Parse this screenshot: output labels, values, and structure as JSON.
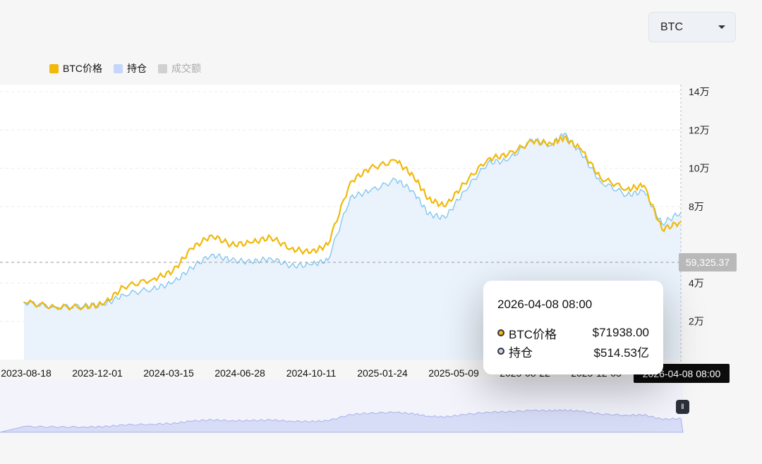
{
  "dropdown": {
    "value": "BTC"
  },
  "legend": [
    {
      "label": "BTC价格",
      "color": "#f0b90b",
      "active": true
    },
    {
      "label": "持仓",
      "color": "#c5d6fb",
      "active": true
    },
    {
      "label": "成交额",
      "color": "#c9c9c9",
      "active": false
    }
  ],
  "crosshair": {
    "price_label": "59,325.37",
    "time_label": "2026-04-08 08:00"
  },
  "tooltip": {
    "date": "2026-04-08 08:00",
    "rows": [
      {
        "label": "BTC价格",
        "value": "$71938.00",
        "color": "#f0b90b"
      },
      {
        "label": "持仓",
        "value": "$514.53亿",
        "color": "#c5d6fb"
      }
    ]
  },
  "chart_data": {
    "type": "line",
    "y_tick_labels": [
      "14万",
      "12万",
      "10万",
      "8万",
      "4万",
      "2万"
    ],
    "y_tick_values": [
      140000,
      120000,
      100000,
      80000,
      40000,
      20000
    ],
    "x_tick_labels": [
      "2023-08-18",
      "2023-12-01",
      "2024-03-15",
      "2024-06-28",
      "2024-10-11",
      "2025-01-24",
      "2025-05-09",
      "2025-08-22",
      "2025-12-05",
      "2026-04-08 08:00"
    ],
    "ylim": [
      0,
      140000
    ],
    "series": [
      {
        "name": "BTC价格",
        "color": "#f0b90b",
        "x": [
          "2023-07-01",
          "2023-08-18",
          "2023-10-01",
          "2023-11-01",
          "2023-12-01",
          "2024-01-15",
          "2024-02-15",
          "2024-03-15",
          "2024-04-15",
          "2024-05-15",
          "2024-06-15",
          "2024-07-15",
          "2024-08-15",
          "2024-09-15",
          "2024-10-11",
          "2024-11-15",
          "2024-12-15",
          "2025-01-24",
          "2025-02-20",
          "2025-03-15",
          "2025-04-10",
          "2025-05-09",
          "2025-06-15",
          "2025-07-15",
          "2025-08-22",
          "2025-09-20",
          "2025-10-10",
          "2025-11-05",
          "2025-12-05",
          "2026-01-15",
          "2026-02-10",
          "2026-03-10",
          "2026-04-08"
        ],
        "values": [
          30000,
          27500,
          27500,
          29000,
          38000,
          42000,
          46000,
          58000,
          65000,
          60000,
          61000,
          64000,
          58000,
          56000,
          60000,
          93000,
          100000,
          104000,
          96000,
          84000,
          80000,
          92000,
          105000,
          107000,
          114000,
          113000,
          116000,
          110000,
          95000,
          89000,
          91000,
          68000,
          71938
        ]
      },
      {
        "name": "持仓",
        "color": "#7dc4ef",
        "x": [
          "2023-07-01",
          "2023-08-18",
          "2023-10-01",
          "2023-11-01",
          "2023-12-01",
          "2024-01-15",
          "2024-02-15",
          "2024-03-15",
          "2024-04-15",
          "2024-05-15",
          "2024-06-15",
          "2024-07-15",
          "2024-08-15",
          "2024-09-15",
          "2024-10-11",
          "2024-11-15",
          "2024-12-15",
          "2025-01-24",
          "2025-02-20",
          "2025-03-15",
          "2025-04-10",
          "2025-05-09",
          "2025-06-15",
          "2025-07-15",
          "2025-08-22",
          "2025-09-20",
          "2025-10-10",
          "2025-11-05",
          "2025-12-05",
          "2026-01-15",
          "2026-02-10",
          "2026-03-10",
          "2026-04-08"
        ],
        "values": [
          30000,
          27500,
          28000,
          28500,
          34000,
          37000,
          40000,
          48000,
          55000,
          52000,
          51000,
          53000,
          49000,
          49500,
          52000,
          85000,
          88000,
          94000,
          88000,
          76000,
          74000,
          88000,
          103000,
          104000,
          115000,
          112000,
          118000,
          108000,
          93000,
          86000,
          88000,
          71000,
          77000
        ]
      }
    ]
  }
}
